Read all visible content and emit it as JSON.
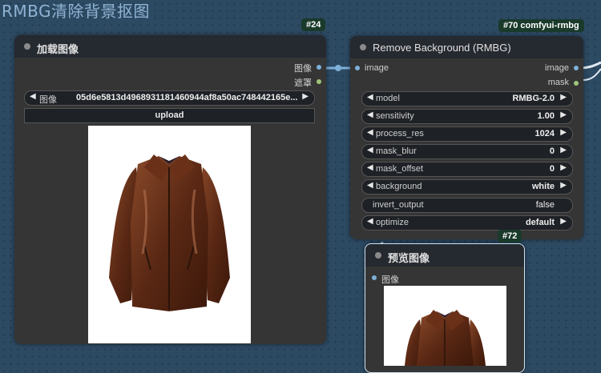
{
  "group": {
    "title": "RMBG清除背景抠图"
  },
  "load_node": {
    "badge": "#24",
    "title": "加载图像",
    "outputs": [
      {
        "label": "图像",
        "color": "#7fb0d8"
      },
      {
        "label": "遮罩",
        "color": "#9ec47a"
      }
    ],
    "image_widget": {
      "label": "图像",
      "value": "05d6e5813d4968931181460944af8a50ac748442165e..."
    },
    "upload_label": "upload"
  },
  "rmbg_node": {
    "badge": "#70 comfyui-rmbg",
    "title": "Remove Background (RMBG)",
    "input_label": "image",
    "outputs": [
      {
        "label": "image",
        "color": "#7fb0d8"
      },
      {
        "label": "mask",
        "color": "#9ec47a"
      }
    ],
    "widgets": [
      {
        "label": "model",
        "value": "RMBG-2.0",
        "arrows": true
      },
      {
        "label": "sensitivity",
        "value": "1.00",
        "arrows": true
      },
      {
        "label": "process_res",
        "value": "1024",
        "arrows": true
      },
      {
        "label": "mask_blur",
        "value": "0",
        "arrows": true
      },
      {
        "label": "mask_offset",
        "value": "0",
        "arrows": true
      },
      {
        "label": "background",
        "value": "white",
        "arrows": true
      },
      {
        "label": "invert_output",
        "value": "false",
        "arrows": false
      },
      {
        "label": "optimize",
        "value": "default",
        "arrows": true
      }
    ]
  },
  "preview_node": {
    "badge": "#72",
    "title": "预览图像",
    "input_label": "图像"
  },
  "arrow_left": "◀",
  "arrow_right": "▶"
}
